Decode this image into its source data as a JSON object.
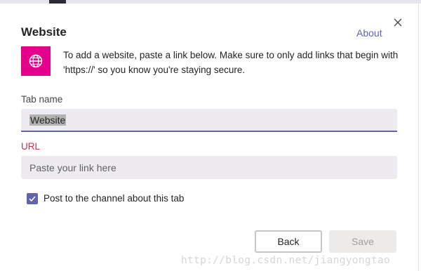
{
  "dialog": {
    "title": "Website",
    "about_label": "About",
    "description": "To add a website, paste a link below. Make sure to only add links that begin with 'https://' so you know you're staying secure.",
    "icon": "globe-icon",
    "accent_color": "#6264a7",
    "icon_bg_color": "#e3008c",
    "error_color": "#c4314b"
  },
  "tab_name": {
    "label": "Tab name",
    "value": "Website"
  },
  "url": {
    "label": "URL",
    "placeholder": "Paste your link here"
  },
  "post_to_channel": {
    "label": "Post to the channel about this tab",
    "checked": true
  },
  "buttons": {
    "back": "Back",
    "save": "Save"
  },
  "watermark": "http://blog.csdn.net/jiangyongtao"
}
